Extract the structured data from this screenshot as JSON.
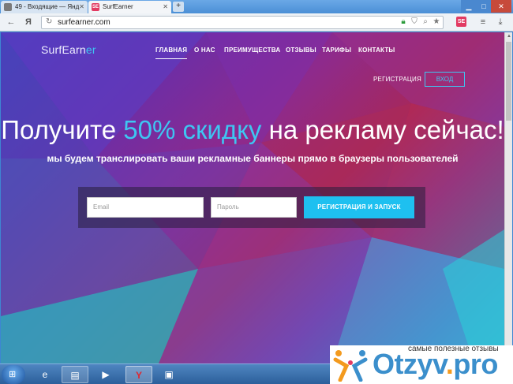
{
  "browser": {
    "tabs": [
      {
        "label": "49 - Входящие — Янд"
      },
      {
        "label": "SurfEarner",
        "favicon": "SE"
      }
    ],
    "url": "surfearner.com",
    "back_label": "←",
    "yandex_label": "Я"
  },
  "site": {
    "logo_main": "SurfEarn",
    "logo_accent": "er",
    "nav": [
      "ГЛАВНАЯ",
      "О НАС",
      "ПРЕИМУЩЕСТВА",
      "ОТЗЫВЫ",
      "ТАРИФЫ",
      "КОНТАКТЫ"
    ],
    "register_link": "РЕГИСТРАЦИЯ",
    "login_button": "ВХОД",
    "headline_before": "Получите ",
    "headline_highlight": "50% скидку",
    "headline_after": " на рекламу сейчас!",
    "subline": "мы будем транслировать ваши рекламные баннеры прямо в браузеры пользователей",
    "email_placeholder": "Email",
    "password_placeholder": "Пароль",
    "submit_label": "РЕГИСТРАЦИЯ И ЗАПУСК"
  },
  "watermark": {
    "tagline": "самые полезные отзывы",
    "logo_main": "Otzyv",
    "logo_dot": ".",
    "logo_tld": "pro"
  },
  "colors": {
    "accent": "#3ec6f2",
    "submit": "#1ec0f0",
    "watermark_blue": "#3b8fcc",
    "watermark_orange": "#f39a1e"
  }
}
